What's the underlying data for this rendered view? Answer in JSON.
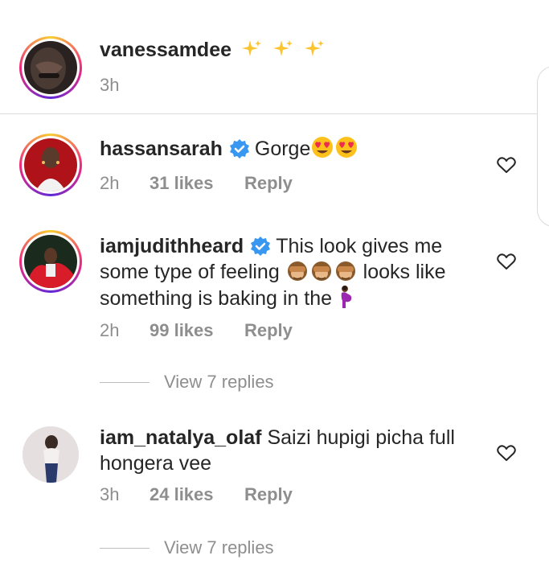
{
  "post_caption": {
    "username": "vanessamdee",
    "timestamp": "3h",
    "emojis": [
      "sparkles",
      "sparkles",
      "sparkles"
    ]
  },
  "comments": [
    {
      "username": "hassansarah",
      "verified": true,
      "text": "Gorge",
      "emojis": [
        "heart-eyes",
        "heart-eyes"
      ],
      "time": "2h",
      "likes": "31 likes",
      "reply": "Reply"
    },
    {
      "username": "iamjudithheard",
      "verified": true,
      "text_part1": "This look gives me",
      "text_part2": "some type of feeling",
      "text_part3": "looks like",
      "text_part4": "something is baking in the",
      "emojis": [
        "see-no-evil-monkey",
        "see-no-evil-monkey",
        "see-no-evil-monkey",
        "pregnant-woman"
      ],
      "time": "2h",
      "likes": "99 likes",
      "reply": "Reply",
      "view_replies": "View 7 replies"
    },
    {
      "username": "iam_natalya_olaf",
      "verified": false,
      "text_part1": "Saizi hupigi picha full",
      "text_part2": "hongera vee",
      "time": "3h",
      "likes": "24 likes",
      "reply": "Reply",
      "view_replies": "View 7 replies"
    }
  ],
  "colors": {
    "username": "#262626",
    "meta": "#8e8e8e",
    "verified_badge": "#3897f0",
    "divider": "#dbdbdb"
  }
}
